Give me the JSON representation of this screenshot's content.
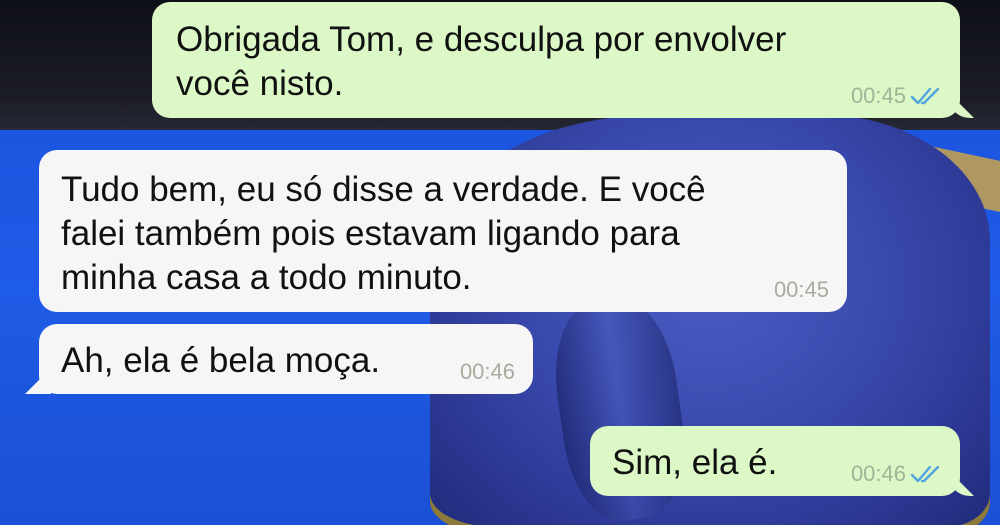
{
  "messages": [
    {
      "id": "msg1",
      "direction": "outgoing",
      "text": "Obrigada Tom, e desculpa por envolver\nvocê nisto.",
      "time": "00:45",
      "status_icon": "double-check-icon",
      "status_color": "#4fa3e0"
    },
    {
      "id": "msg2",
      "direction": "incoming",
      "text": "Tudo bem, eu só disse a verdade. E você\nfalei também pois estavam ligando para\nminha casa a todo minuto.",
      "time": "00:45"
    },
    {
      "id": "msg3",
      "direction": "incoming",
      "text": "Ah, ela é bela moça.",
      "time": "00:46"
    },
    {
      "id": "msg4",
      "direction": "outgoing",
      "text": "Sim, ela é.",
      "time": "00:46",
      "status_icon": "double-check-icon",
      "status_color": "#4fa3e0"
    }
  ],
  "colors": {
    "outgoing_bubble": "#dcf8c6",
    "incoming_bubble": "#f6f6f6",
    "read_check": "#4fa3e0"
  }
}
